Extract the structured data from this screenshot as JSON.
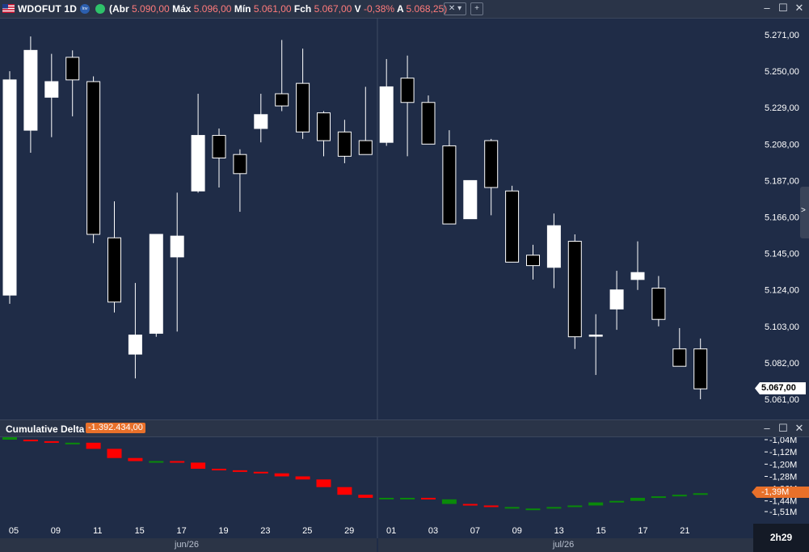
{
  "header": {
    "symbol": "WDOFUT 1D",
    "badge_text": "Investor",
    "ohlc": {
      "open_label": "(Abr",
      "open": "5.090,00",
      "high_label": "Máx",
      "high": "5.096,00",
      "low_label": "Mín",
      "low": "5.061,00",
      "close_label": "Fch",
      "close": "5.067,00",
      "var_label": "V",
      "var": "-0,38%",
      "avg_label": "A",
      "avg": "5.068,25)"
    },
    "colors": {
      "up": "#ffffff",
      "down": "#000000",
      "value_text": "#ff7b7b"
    }
  },
  "price_scale": {
    "ticks": [
      "5.271,00",
      "5.250,00",
      "5.229,00",
      "5.208,00",
      "5.187,00",
      "5.166,00",
      "5.145,00",
      "5.124,00",
      "5.103,00",
      "5.082,00",
      "5.061,00"
    ],
    "last_price_label": "5.067,00"
  },
  "indicator": {
    "name": "Cumulative Delta",
    "value_badge": "-1.392.434,00",
    "ticks": [
      "-1,04M",
      "-1,12M",
      "-1,20M",
      "-1,28M",
      "-1,36M",
      "-1,44M",
      "-1,51M"
    ],
    "last_value_label": "-1,39M",
    "colors": {
      "positive": "#0a8a0a",
      "negative": "#ff0000",
      "badge": "#e8702a"
    }
  },
  "time_axis": {
    "day_labels": [
      "05",
      "09",
      "11",
      "15",
      "17",
      "19",
      "23",
      "25",
      "29",
      "01",
      "03",
      "07",
      "09",
      "13",
      "15",
      "17",
      "21"
    ],
    "month_labels": [
      "jun/26",
      "jul/26"
    ]
  },
  "timer": "2h29",
  "chart_data": [
    {
      "type": "candlestick",
      "title": "WDOFUT 1D",
      "ylim": [
        5056,
        5276
      ],
      "candles": [
        {
          "o": 5121,
          "h": 5250,
          "l": 5116,
          "c": 5245
        },
        {
          "o": 5216,
          "h": 5270,
          "l": 5203,
          "c": 5262
        },
        {
          "o": 5235,
          "h": 5260,
          "l": 5212,
          "c": 5244
        },
        {
          "o": 5258,
          "h": 5262,
          "l": 5224,
          "c": 5245
        },
        {
          "o": 5244,
          "h": 5247,
          "l": 5151,
          "c": 5156
        },
        {
          "o": 5154,
          "h": 5175,
          "l": 5111,
          "c": 5117
        },
        {
          "o": 5087,
          "h": 5128,
          "l": 5073,
          "c": 5098
        },
        {
          "o": 5099,
          "h": 5152,
          "l": 5097,
          "c": 5156
        },
        {
          "o": 5143,
          "h": 5180,
          "l": 5100,
          "c": 5155
        },
        {
          "o": 5181,
          "h": 5237,
          "l": 5180,
          "c": 5213
        },
        {
          "o": 5213,
          "h": 5217,
          "l": 5183,
          "c": 5200
        },
        {
          "o": 5202,
          "h": 5205,
          "l": 5169,
          "c": 5191
        },
        {
          "o": 5217,
          "h": 5237,
          "l": 5209,
          "c": 5225
        },
        {
          "o": 5237,
          "h": 5268,
          "l": 5227,
          "c": 5230
        },
        {
          "o": 5243,
          "h": 5263,
          "l": 5211,
          "c": 5215
        },
        {
          "o": 5226,
          "h": 5227,
          "l": 5201,
          "c": 5210
        },
        {
          "o": 5215,
          "h": 5222,
          "l": 5197,
          "c": 5201
        },
        {
          "o": 5210,
          "h": 5241,
          "l": 5203,
          "c": 5202
        },
        {
          "o": 5209,
          "h": 5257,
          "l": 5207,
          "c": 5241
        },
        {
          "o": 5246,
          "h": 5259,
          "l": 5201,
          "c": 5232
        },
        {
          "o": 5232,
          "h": 5236,
          "l": 5214,
          "c": 5208
        },
        {
          "o": 5207,
          "h": 5216,
          "l": 5174,
          "c": 5162
        },
        {
          "o": 5165,
          "h": 5172,
          "l": 5171,
          "c": 5187
        },
        {
          "o": 5210,
          "h": 5211,
          "l": 5167,
          "c": 5183
        },
        {
          "o": 5181,
          "h": 5184,
          "l": 5143,
          "c": 5140
        },
        {
          "o": 5144,
          "h": 5150,
          "l": 5130,
          "c": 5138
        },
        {
          "o": 5137,
          "h": 5168,
          "l": 5125,
          "c": 5161
        },
        {
          "o": 5152,
          "h": 5156,
          "l": 5090,
          "c": 5097
        },
        {
          "o": 5098,
          "h": 5110,
          "l": 5075,
          "c": 5098
        },
        {
          "o": 5113,
          "h": 5135,
          "l": 5101,
          "c": 5124
        },
        {
          "o": 5130,
          "h": 5152,
          "l": 5124,
          "c": 5134
        },
        {
          "o": 5125,
          "h": 5132,
          "l": 5103,
          "c": 5107
        },
        {
          "o": 5090,
          "h": 5102,
          "l": 5082,
          "c": 5080
        },
        {
          "o": 5090,
          "h": 5096,
          "l": 5061,
          "c": 5067
        }
      ],
      "last_price": 5067
    },
    {
      "type": "bar",
      "title": "Cumulative Delta",
      "ylim": [
        -1.52,
        -1.03
      ],
      "values": [
        -1.04,
        -1.05,
        -1.06,
        -1.06,
        -1.1,
        -1.16,
        -1.18,
        -1.18,
        -1.19,
        -1.23,
        -1.24,
        -1.25,
        -1.26,
        -1.28,
        -1.3,
        -1.35,
        -1.4,
        -1.42,
        -1.42,
        -1.42,
        -1.43,
        -1.46,
        -1.47,
        -1.48,
        -1.49,
        -1.49,
        -1.48,
        -1.47,
        -1.45,
        -1.44,
        -1.42,
        -1.41,
        -1.4,
        -1.39
      ],
      "colors": [
        "green",
        "red",
        "red",
        "green",
        "red",
        "red",
        "red",
        "green",
        "red",
        "red",
        "red",
        "red",
        "red",
        "red",
        "red",
        "red",
        "red",
        "red",
        "green",
        "green",
        "red",
        "green",
        "red",
        "red",
        "green",
        "green",
        "green",
        "green",
        "green",
        "green",
        "green",
        "green",
        "green",
        "green"
      ],
      "last_value": -1.39
    }
  ]
}
